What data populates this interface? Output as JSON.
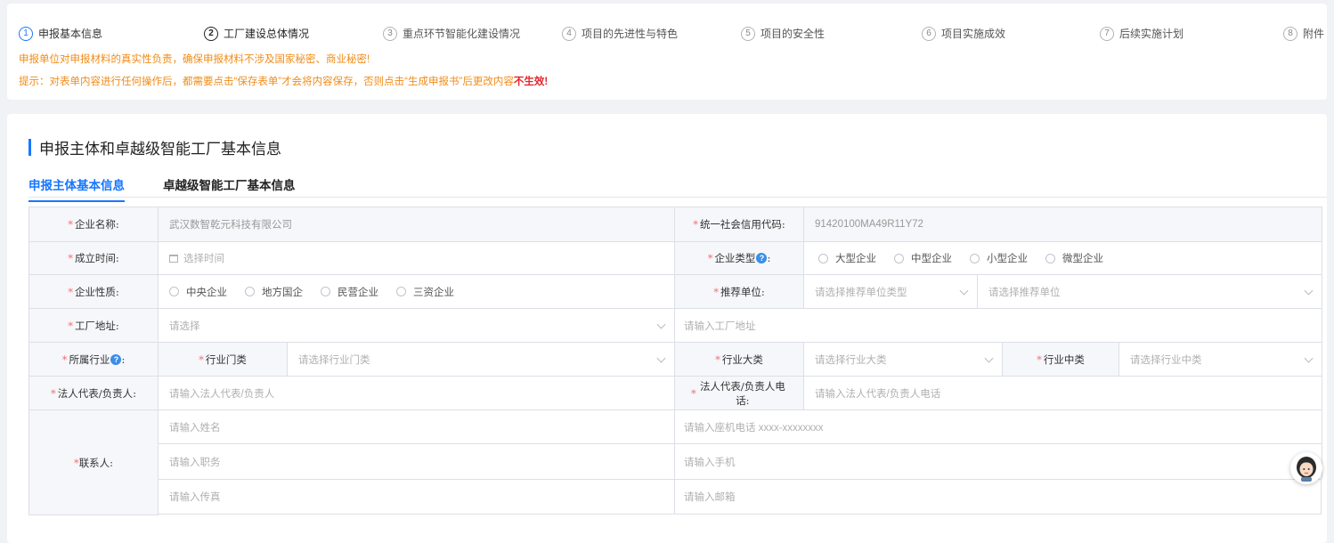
{
  "steps": [
    {
      "num": "1",
      "label": "申报基本信息",
      "state": "active"
    },
    {
      "num": "2",
      "label": "工厂建设总体情况",
      "state": "done"
    },
    {
      "num": "3",
      "label": "重点环节智能化建设情况",
      "state": ""
    },
    {
      "num": "4",
      "label": "项目的先进性与特色",
      "state": ""
    },
    {
      "num": "5",
      "label": "项目的安全性",
      "state": ""
    },
    {
      "num": "6",
      "label": "项目实施成效",
      "state": ""
    },
    {
      "num": "7",
      "label": "后续实施计划",
      "state": ""
    },
    {
      "num": "8",
      "label": "附件",
      "state": ""
    }
  ],
  "notices": {
    "line1": "申报单位对申报材料的真实性负责，确保申报材料不涉及国家秘密、商业秘密!",
    "line2_prefix": "提示：对表单内容进行任何操作后，都需要点击“保存表单”才会将内容保存，否则点击“生成申报书”后更改内容",
    "line2_strong": "不生效!"
  },
  "section": {
    "title": "申报主体和卓越级智能工厂基本信息",
    "tabs": [
      {
        "label": "申报主体基本信息",
        "active": true
      },
      {
        "label": "卓越级智能工厂基本信息",
        "active": false
      }
    ]
  },
  "form": {
    "company_name": {
      "label": "企业名称:",
      "value": "武汉数智乾元科技有限公司"
    },
    "credit_code": {
      "label": "统一社会信用代码:",
      "value": "91420100MA49R11Y72"
    },
    "established": {
      "label": "成立时间:",
      "placeholder": "选择时间"
    },
    "company_type": {
      "label": "企业类型",
      "options": [
        "大型企业",
        "中型企业",
        "小型企业",
        "微型企业"
      ]
    },
    "nature": {
      "label": "企业性质:",
      "options": [
        "中央企业",
        "地方国企",
        "民营企业",
        "三资企业"
      ]
    },
    "recommender": {
      "label": "推荐单位:",
      "type_placeholder": "请选择推荐单位类型",
      "unit_placeholder": "请选择推荐单位"
    },
    "factory_address": {
      "label": "工厂地址:",
      "select_placeholder": "请选择",
      "input_placeholder": "请输入工厂地址"
    },
    "industry": {
      "label": "所属行业",
      "category_label": "行业门类",
      "category_placeholder": "请选择行业门类",
      "major_label": "行业大类",
      "major_placeholder": "请选择行业大类",
      "middle_label": "行业中类",
      "middle_placeholder": "请选择行业中类"
    },
    "legal_rep": {
      "label": "法人代表/负责人:",
      "placeholder": "请输入法人代表/负责人"
    },
    "legal_phone": {
      "label": "法人代表/负责人电话:",
      "placeholder": "请输入法人代表/负责人电话"
    },
    "contact": {
      "label": "联系人:",
      "name_placeholder": "请输入姓名",
      "landline_placeholder": "请输入座机电话 xxxx-xxxxxxxx",
      "title_placeholder": "请输入职务",
      "mobile_placeholder": "请输入手机",
      "fax_placeholder": "请输入传真",
      "email_placeholder": "请输入邮箱"
    }
  },
  "required_mark": "*",
  "help_mark": "?",
  "colors": {
    "primary": "#1677ff",
    "warning": "#f08c19",
    "danger": "#e5242b",
    "required": "#f56c6c"
  }
}
